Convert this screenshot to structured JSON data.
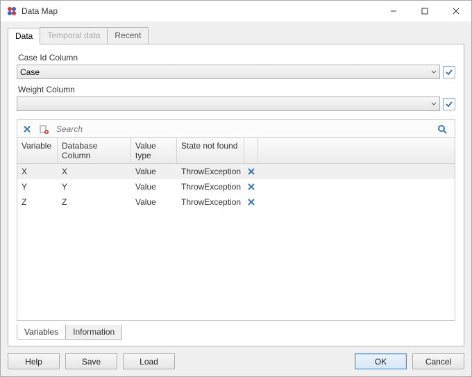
{
  "window": {
    "title": "Data Map"
  },
  "tabs": {
    "data": "Data",
    "temporal": "Temporal data",
    "recent": "Recent"
  },
  "form": {
    "case_label": "Case Id Column",
    "case_value": "Case",
    "weight_label": "Weight Column",
    "weight_value": ""
  },
  "search": {
    "placeholder": "Search"
  },
  "grid": {
    "headers": {
      "variable": "Variable",
      "db": "Database Column",
      "vtype": "Value type",
      "state": "State not found"
    },
    "rows": [
      {
        "variable": "X",
        "db": "X",
        "vtype": "Value",
        "state": "ThrowException"
      },
      {
        "variable": "Y",
        "db": "Y",
        "vtype": "Value",
        "state": "ThrowException"
      },
      {
        "variable": "Z",
        "db": "Z",
        "vtype": "Value",
        "state": "ThrowException"
      }
    ]
  },
  "bottom_tabs": {
    "variables": "Variables",
    "info": "Information"
  },
  "buttons": {
    "help": "Help",
    "save": "Save",
    "load": "Load",
    "ok": "OK",
    "cancel": "Cancel"
  },
  "colors": {
    "accent": "#4a90d9",
    "icon_blue": "#3b78b5",
    "icon_red": "#c0392b"
  }
}
